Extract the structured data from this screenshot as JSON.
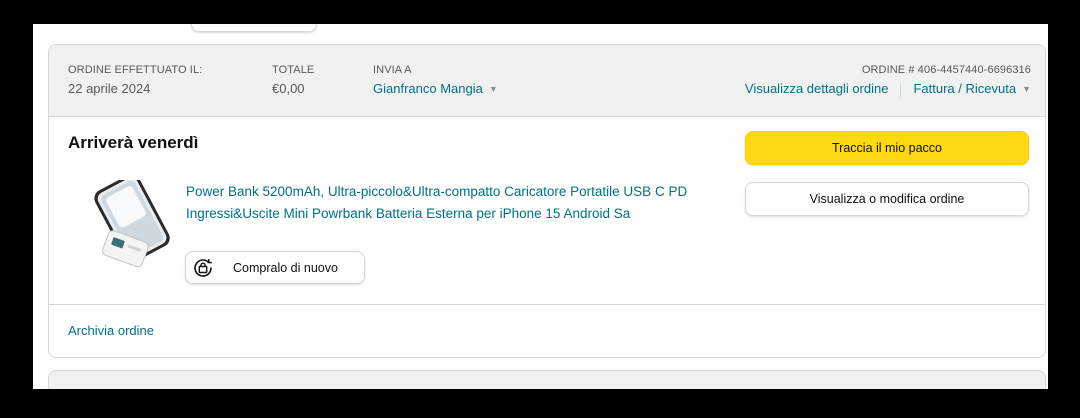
{
  "order_header": {
    "placed_label": "ORDINE EFFETTUATO IL:",
    "placed_value": "22 aprile 2024",
    "total_label": "TOTALE",
    "total_value": "€0,00",
    "ship_to_label": "INVIA A",
    "ship_to_value": "Gianfranco Mangia",
    "order_number": "ORDINE # 406-4457440-6696316",
    "details_link": "Visualizza dettagli ordine",
    "invoice_link": "Fattura / Ricevuta"
  },
  "delivery": {
    "status": "Arriverà venerdì"
  },
  "product": {
    "title": "Power Bank 5200mAh, Ultra-piccolo&Ultra-compatto Caricatore Portatile USB C PD Ingressi&Uscite Mini Powrbank Batteria Esterna per iPhone 15 Android Sa",
    "buy_again_label": "Compralo di nuovo"
  },
  "actions": {
    "track_label": "Traccia il mio pacco",
    "view_modify_label": "Visualizza o modifica ordine"
  },
  "footer": {
    "archive_label": "Archivia ordine"
  },
  "colors": {
    "accent_yellow": "#ffd814",
    "link": "#007185",
    "header_bg": "#f0f2f2"
  },
  "icons": [
    "chevron-down-icon",
    "buy-again-icon"
  ]
}
